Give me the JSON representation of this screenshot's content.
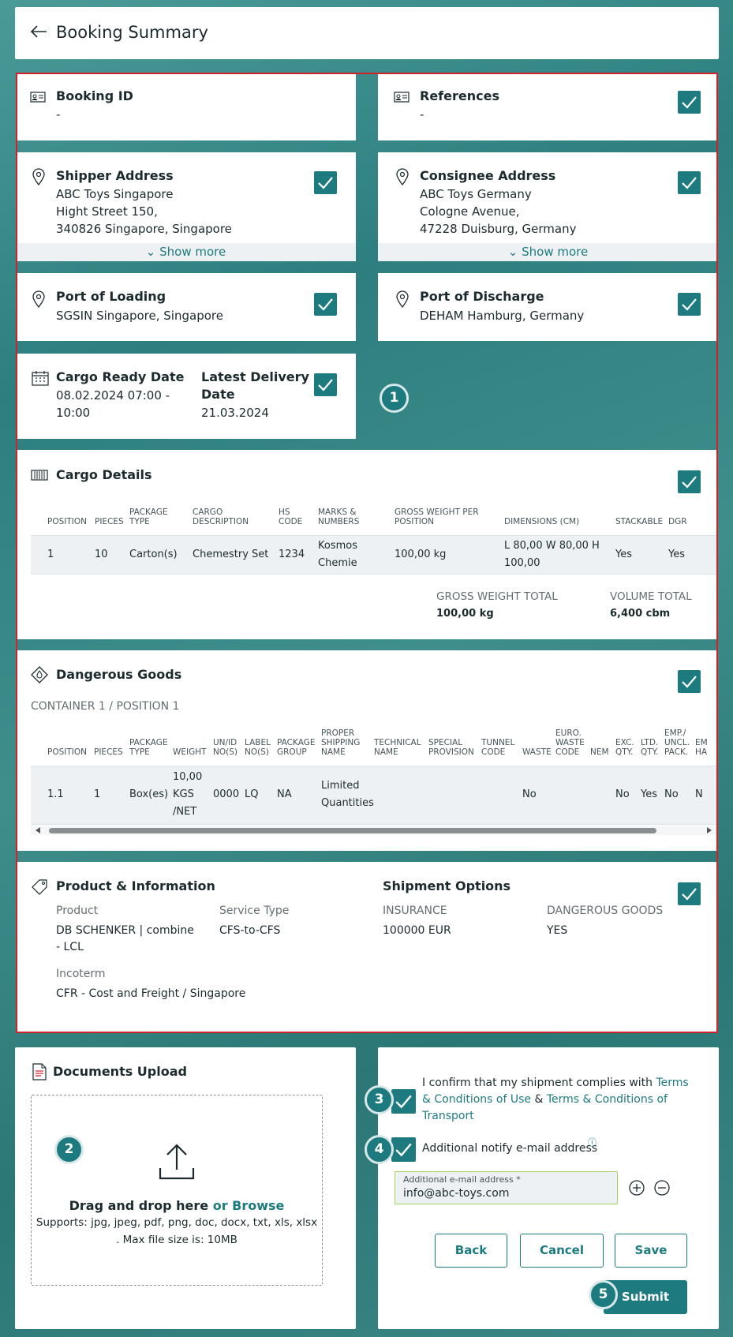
{
  "header": {
    "title": "Booking Summary"
  },
  "booking": {
    "label": "Booking ID",
    "value": "-"
  },
  "references": {
    "label": "References",
    "value": "-"
  },
  "shipper": {
    "label": "Shipper Address",
    "line1": "ABC Toys Singapore",
    "line2": "Hight Street 150,",
    "line3": "340826 Singapore, Singapore",
    "show_more": "Show more"
  },
  "consignee": {
    "label": "Consignee Address",
    "line1": "ABC Toys Germany",
    "line2": "Cologne Avenue,",
    "line3": "47228 Duisburg, Germany",
    "show_more": "Show more"
  },
  "pol": {
    "label": "Port of Loading",
    "value": "SGSIN Singapore, Singapore"
  },
  "pod": {
    "label": "Port of Discharge",
    "value": "DEHAM Hamburg, Germany"
  },
  "dates": {
    "ready_label": "Cargo Ready Date",
    "ready_value1": "08.02.2024 07:00 -",
    "ready_value2": "10:00",
    "delivery_label1": "Latest Delivery",
    "delivery_label2": "Date",
    "delivery_value": "21.03.2024"
  },
  "cargo": {
    "title": "Cargo Details",
    "headers": [
      "POSITION",
      "PIECES",
      "PACKAGE\nTYPE",
      "CARGO\nDESCRIPTION",
      "HS\nCODE",
      "MARKS &\nNUMBERS",
      "GROSS WEIGHT PER\nPOSITION",
      "DIMENSIONS (CM)",
      "STACKABLE",
      "DGR"
    ],
    "row": [
      "1",
      "10",
      "Carton(s)",
      "Chemestry Set",
      "1234",
      "Kosmos\nChemie",
      "100,00 kg",
      "L 80,00 W 80,00 H\n100,00",
      "Yes",
      "Yes"
    ],
    "gross_label": "GROSS WEIGHT TOTAL",
    "gross_value": "100,00 kg",
    "volume_label": "VOLUME TOTAL",
    "volume_value": "6,400 cbm"
  },
  "dg": {
    "title": "Dangerous Goods",
    "container": "CONTAINER 1 / POSITION 1",
    "headers": [
      "POSITION",
      "PIECES",
      "PACKAGE\nTYPE",
      "WEIGHT",
      "UN/ID\nNO(S)",
      "LABEL\nNO(S)",
      "PACKAGE\nGROUP",
      "PROPER\nSHIPPING\nNAME",
      "TECHNICAL\nNAME",
      "SPECIAL\nPROVISION",
      "TUNNEL\nCODE",
      "WASTE",
      "EURO.\nWASTE\nCODE",
      "NEM",
      "EXC.\nQTY.",
      "LTD.\nQTY.",
      "EMP./\nUNCL.\nPACK.",
      "EM\nHA"
    ],
    "row": [
      "1.1",
      "1",
      "Box(es)",
      "10,00\nKGS\n/NET",
      "0000",
      "LQ",
      "NA",
      "Limited\nQuantities",
      "",
      "",
      "",
      "No",
      "",
      "",
      "No",
      "Yes",
      "No",
      "N"
    ]
  },
  "product": {
    "title": "Product & Information",
    "product_label": "Product",
    "product_value1": "DB SCHENKER | combine",
    "product_value2": "- LCL",
    "service_label": "Service Type",
    "service_value": "CFS-to-CFS",
    "incoterm_label": "Incoterm",
    "incoterm_value": "CFR - Cost and Freight / Singapore"
  },
  "shipment": {
    "title": "Shipment Options",
    "insurance_label": "INSURANCE",
    "insurance_value": "100000 EUR",
    "dg_label": "DANGEROUS GOODS",
    "dg_value": "YES"
  },
  "upload": {
    "title": "Documents Upload",
    "drag": "Drag and drop here",
    "browse": "or Browse",
    "supports1": "Supports: jpg, jpeg, pdf, png, doc, docx, txt, xls, xlsx",
    "supports2": ". Max file size is: 10MB"
  },
  "confirm": {
    "text1": "I confirm that my shipment complies with",
    "link1a": "Terms",
    "link1b": "& Conditions of Use",
    "amp": "&",
    "link2a": "Terms & Conditions of",
    "link2b": "Transport"
  },
  "notify": {
    "label": "Additional notify e-mail address",
    "info": "ⓘ",
    "field_label": "Additional e-mail address *",
    "field_value": "info@abc-toys.com"
  },
  "buttons": {
    "back": "Back",
    "cancel": "Cancel",
    "save": "Save",
    "submit": "Submit"
  },
  "badges": [
    "1",
    "2",
    "3",
    "4",
    "5"
  ],
  "colors": {
    "teal": "#1d7b80",
    "frame": "#d0222b"
  }
}
